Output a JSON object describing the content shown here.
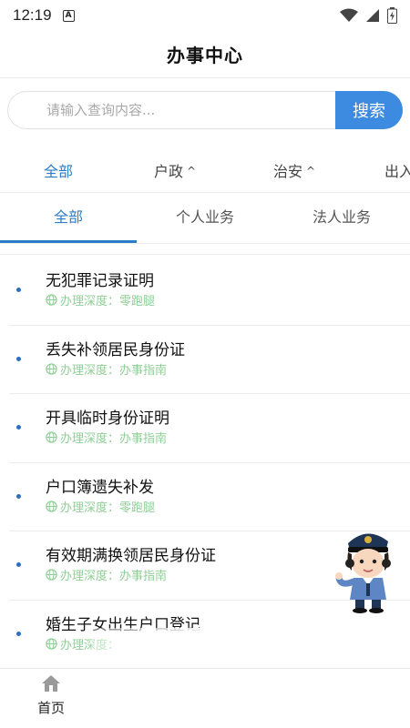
{
  "status_bar": {
    "time": "12:19",
    "notification_letter": "A"
  },
  "header": {
    "title": "办事中心"
  },
  "search": {
    "placeholder": "请输入查询内容...",
    "button_label": "搜索"
  },
  "categories": [
    {
      "label": "全部",
      "active": true
    },
    {
      "label": "户政",
      "caret": "^"
    },
    {
      "label": "治安",
      "caret": "^"
    },
    {
      "label": "出入"
    }
  ],
  "tabs": [
    {
      "label": "全部",
      "active": true
    },
    {
      "label": "个人业务"
    },
    {
      "label": "法人业务"
    }
  ],
  "list": {
    "depth_label": "办理深度：",
    "items": [
      {
        "name": "无犯罪记录证明",
        "depth": "零跑腿"
      },
      {
        "name": "丢失补领居民身份证",
        "depth": "办事指南"
      },
      {
        "name": "开具临时身份证明",
        "depth": "办事指南"
      },
      {
        "name": "户口簿遗失补发",
        "depth": "零跑腿"
      },
      {
        "name": "有效期满换领居民身份证",
        "depth": "办事指南"
      },
      {
        "name": "婚生子女出生户口登记",
        "depth": ""
      }
    ]
  },
  "bottom_nav": {
    "home_label": "首页"
  },
  "colors": {
    "accent": "#2a7cc7",
    "search_button": "#3c8be0",
    "depth_text": "#8fcf95"
  }
}
